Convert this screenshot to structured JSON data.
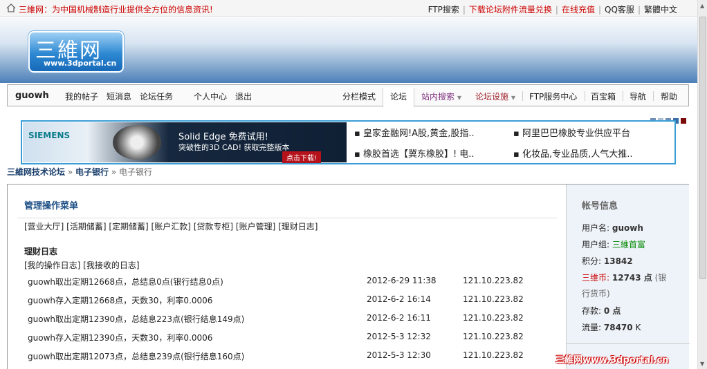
{
  "topbar": {
    "slogan": "三維网：为中国机械制造行业提供全方位的信息资讯!",
    "links": [
      "FTP搜索",
      "下载论坛附件流量兑换",
      "在线充值",
      "QQ客服",
      "繁體中文"
    ]
  },
  "logo": {
    "cn": "三維网",
    "url": "www.3dportal.cn"
  },
  "nav": {
    "user": "guowh",
    "left": [
      "我的帖子",
      "短消息",
      "论坛任务",
      "个人中心",
      "退出"
    ],
    "right": [
      "分栏模式",
      "论坛",
      "站内搜索",
      "论坛设施",
      "FTP服务中心",
      "百宝箱",
      "导航",
      "帮助"
    ]
  },
  "ad": {
    "brand": "SIEMENS",
    "title": "Solid Edge 免费试用!",
    "subtitle": "突破性的3D CAD! 获取完整版本",
    "button": "点击下载!",
    "links": [
      "皇家金融网!A股,黄金,股指..",
      "阿里巴巴橡胶专业供应平台",
      "橡胶首选【冀东橡胶】! 电..",
      "化妆品,专业品质,人气大推.."
    ]
  },
  "breadcrumb": [
    "三維网技术论坛",
    "»",
    "电子银行",
    "»",
    "电子银行"
  ],
  "content": {
    "title": "管理操作菜单",
    "menu": "[营业大厅] [活期储蓄] [定期储蓄] [账户汇款] [贷款专柜] [账户管理] [理财日志]",
    "section": "理财日志",
    "submenu": "[我的操作日志] [我接收的日志]",
    "rows": [
      {
        "desc": "guowh取出定期12668点，总结息0点(银行结息0点)",
        "time": "2012-6-29 11:38",
        "ip": "121.10.223.82"
      },
      {
        "desc": "guowh存入定期12668点，天数30，利率0.0006",
        "time": "2012-6-2 16:14",
        "ip": "121.10.223.82"
      },
      {
        "desc": "guowh取出定期12390点，总结息223点(银行结息149点)",
        "time": "2012-6-2 16:11",
        "ip": "121.10.223.82"
      },
      {
        "desc": "guowh存入定期12390点，天数30，利率0.0006",
        "time": "2012-5-3 12:32",
        "ip": "121.10.223.82"
      },
      {
        "desc": "guowh取出定期12073点，总结息239点(银行结息160点)",
        "time": "2012-5-3 12:30",
        "ip": "121.10.223.82"
      }
    ]
  },
  "account": {
    "header": "帐号信息",
    "username_label": "用户名:",
    "username": "guowh",
    "group_label": "用户组:",
    "group": "三維首富",
    "points_label": "积分:",
    "points": "13842",
    "coin_label": "三维币:",
    "coin": "12743 点",
    "coin_note": "(银",
    "coin_note2": "行货币)",
    "deposit_label": "存款:",
    "deposit": "0 点",
    "traffic_label": "流量:",
    "traffic": "78470",
    "traffic_unit": "K"
  },
  "watermark": "三維网www.3dportal.cn",
  "colors": {
    "accent": "#1c4f85",
    "red": "#cc0000",
    "green": "#008800"
  }
}
